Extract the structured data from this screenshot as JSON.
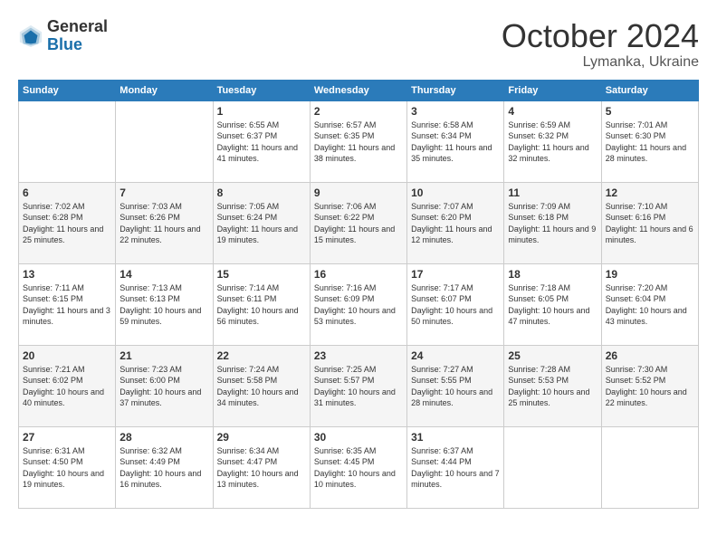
{
  "header": {
    "logo_general": "General",
    "logo_blue": "Blue",
    "month_title": "October 2024",
    "location": "Lymanka, Ukraine"
  },
  "days_of_week": [
    "Sunday",
    "Monday",
    "Tuesday",
    "Wednesday",
    "Thursday",
    "Friday",
    "Saturday"
  ],
  "weeks": [
    [
      {
        "day": "",
        "info": ""
      },
      {
        "day": "",
        "info": ""
      },
      {
        "day": "1",
        "info": "Sunrise: 6:55 AM\nSunset: 6:37 PM\nDaylight: 11 hours and 41 minutes."
      },
      {
        "day": "2",
        "info": "Sunrise: 6:57 AM\nSunset: 6:35 PM\nDaylight: 11 hours and 38 minutes."
      },
      {
        "day": "3",
        "info": "Sunrise: 6:58 AM\nSunset: 6:34 PM\nDaylight: 11 hours and 35 minutes."
      },
      {
        "day": "4",
        "info": "Sunrise: 6:59 AM\nSunset: 6:32 PM\nDaylight: 11 hours and 32 minutes."
      },
      {
        "day": "5",
        "info": "Sunrise: 7:01 AM\nSunset: 6:30 PM\nDaylight: 11 hours and 28 minutes."
      }
    ],
    [
      {
        "day": "6",
        "info": "Sunrise: 7:02 AM\nSunset: 6:28 PM\nDaylight: 11 hours and 25 minutes."
      },
      {
        "day": "7",
        "info": "Sunrise: 7:03 AM\nSunset: 6:26 PM\nDaylight: 11 hours and 22 minutes."
      },
      {
        "day": "8",
        "info": "Sunrise: 7:05 AM\nSunset: 6:24 PM\nDaylight: 11 hours and 19 minutes."
      },
      {
        "day": "9",
        "info": "Sunrise: 7:06 AM\nSunset: 6:22 PM\nDaylight: 11 hours and 15 minutes."
      },
      {
        "day": "10",
        "info": "Sunrise: 7:07 AM\nSunset: 6:20 PM\nDaylight: 11 hours and 12 minutes."
      },
      {
        "day": "11",
        "info": "Sunrise: 7:09 AM\nSunset: 6:18 PM\nDaylight: 11 hours and 9 minutes."
      },
      {
        "day": "12",
        "info": "Sunrise: 7:10 AM\nSunset: 6:16 PM\nDaylight: 11 hours and 6 minutes."
      }
    ],
    [
      {
        "day": "13",
        "info": "Sunrise: 7:11 AM\nSunset: 6:15 PM\nDaylight: 11 hours and 3 minutes."
      },
      {
        "day": "14",
        "info": "Sunrise: 7:13 AM\nSunset: 6:13 PM\nDaylight: 10 hours and 59 minutes."
      },
      {
        "day": "15",
        "info": "Sunrise: 7:14 AM\nSunset: 6:11 PM\nDaylight: 10 hours and 56 minutes."
      },
      {
        "day": "16",
        "info": "Sunrise: 7:16 AM\nSunset: 6:09 PM\nDaylight: 10 hours and 53 minutes."
      },
      {
        "day": "17",
        "info": "Sunrise: 7:17 AM\nSunset: 6:07 PM\nDaylight: 10 hours and 50 minutes."
      },
      {
        "day": "18",
        "info": "Sunrise: 7:18 AM\nSunset: 6:05 PM\nDaylight: 10 hours and 47 minutes."
      },
      {
        "day": "19",
        "info": "Sunrise: 7:20 AM\nSunset: 6:04 PM\nDaylight: 10 hours and 43 minutes."
      }
    ],
    [
      {
        "day": "20",
        "info": "Sunrise: 7:21 AM\nSunset: 6:02 PM\nDaylight: 10 hours and 40 minutes."
      },
      {
        "day": "21",
        "info": "Sunrise: 7:23 AM\nSunset: 6:00 PM\nDaylight: 10 hours and 37 minutes."
      },
      {
        "day": "22",
        "info": "Sunrise: 7:24 AM\nSunset: 5:58 PM\nDaylight: 10 hours and 34 minutes."
      },
      {
        "day": "23",
        "info": "Sunrise: 7:25 AM\nSunset: 5:57 PM\nDaylight: 10 hours and 31 minutes."
      },
      {
        "day": "24",
        "info": "Sunrise: 7:27 AM\nSunset: 5:55 PM\nDaylight: 10 hours and 28 minutes."
      },
      {
        "day": "25",
        "info": "Sunrise: 7:28 AM\nSunset: 5:53 PM\nDaylight: 10 hours and 25 minutes."
      },
      {
        "day": "26",
        "info": "Sunrise: 7:30 AM\nSunset: 5:52 PM\nDaylight: 10 hours and 22 minutes."
      }
    ],
    [
      {
        "day": "27",
        "info": "Sunrise: 6:31 AM\nSunset: 4:50 PM\nDaylight: 10 hours and 19 minutes."
      },
      {
        "day": "28",
        "info": "Sunrise: 6:32 AM\nSunset: 4:49 PM\nDaylight: 10 hours and 16 minutes."
      },
      {
        "day": "29",
        "info": "Sunrise: 6:34 AM\nSunset: 4:47 PM\nDaylight: 10 hours and 13 minutes."
      },
      {
        "day": "30",
        "info": "Sunrise: 6:35 AM\nSunset: 4:45 PM\nDaylight: 10 hours and 10 minutes."
      },
      {
        "day": "31",
        "info": "Sunrise: 6:37 AM\nSunset: 4:44 PM\nDaylight: 10 hours and 7 minutes."
      },
      {
        "day": "",
        "info": ""
      },
      {
        "day": "",
        "info": ""
      }
    ]
  ]
}
